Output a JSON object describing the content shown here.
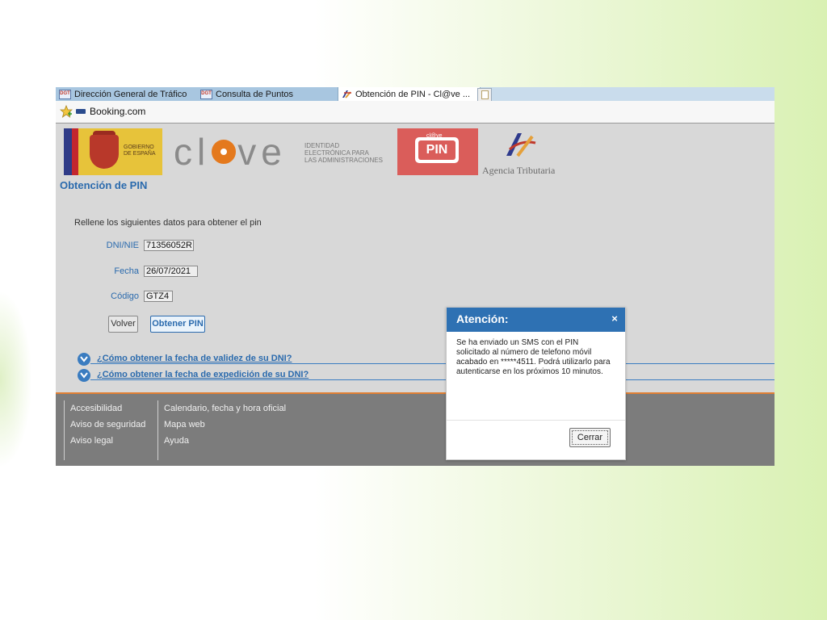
{
  "browser": {
    "tabs": [
      {
        "label": "Dirección General de Tráfico",
        "favicon": "dgt-favicon"
      },
      {
        "label": "Consulta de Puntos",
        "favicon": "dgt-favicon"
      },
      {
        "label": "Obtención de PIN - Cl@ve ...",
        "favicon": "aeat-favicon",
        "active": true
      }
    ],
    "tab_close_glyph": "×",
    "bookmarks": [
      {
        "label": "Booking.com"
      }
    ]
  },
  "header": {
    "gobierno_text": "GOBIERNO\nDE ESPAÑA",
    "clave_letters": [
      "cl",
      "ve"
    ],
    "clave_subtitle": "IDENTIDAD\nELECTRÓNICA PARA\nLAS ADMINISTRACIONES",
    "pin_small": "cl@ve",
    "pin_big": "PIN",
    "agency": "Agencia Tributaria"
  },
  "page": {
    "title": "Obtención de PIN",
    "instructions": "Rellene los siguientes datos para obtener el pin",
    "fields": {
      "dni": {
        "label": "DNI/NIE",
        "value": "71356052R"
      },
      "fecha": {
        "label": "Fecha",
        "value": "26/07/2021"
      },
      "codigo": {
        "label": "Código",
        "value": "GTZ4"
      }
    },
    "buttons": {
      "volver": "Volver",
      "obtener": "Obtener PIN"
    },
    "faqs": [
      "¿Cómo obtener la fecha de validez de su DNI?",
      "¿Cómo obtener la fecha de expedición de su DNI?"
    ]
  },
  "footer": {
    "col1": [
      "Accesibilidad",
      "Aviso de seguridad",
      "Aviso legal"
    ],
    "col2": [
      "Calendario, fecha y hora oficial",
      "Mapa web",
      "Ayuda"
    ]
  },
  "modal": {
    "title": "Atención:",
    "close_glyph": "×",
    "message": "Se ha enviado un SMS con el PIN solicitado al número de telefono móvil acabado en *****4511. Podrá utilizarlo para autenticarse en los próximos 10 minutos.",
    "button": "Cerrar"
  },
  "colors": {
    "accent": "#2e71b3",
    "link": "#2a6aad",
    "footer_bg": "#7c7c7c",
    "footer_accent": "#e07f33",
    "pin_bg": "#da5d5a",
    "clave_orange": "#e4791d"
  }
}
